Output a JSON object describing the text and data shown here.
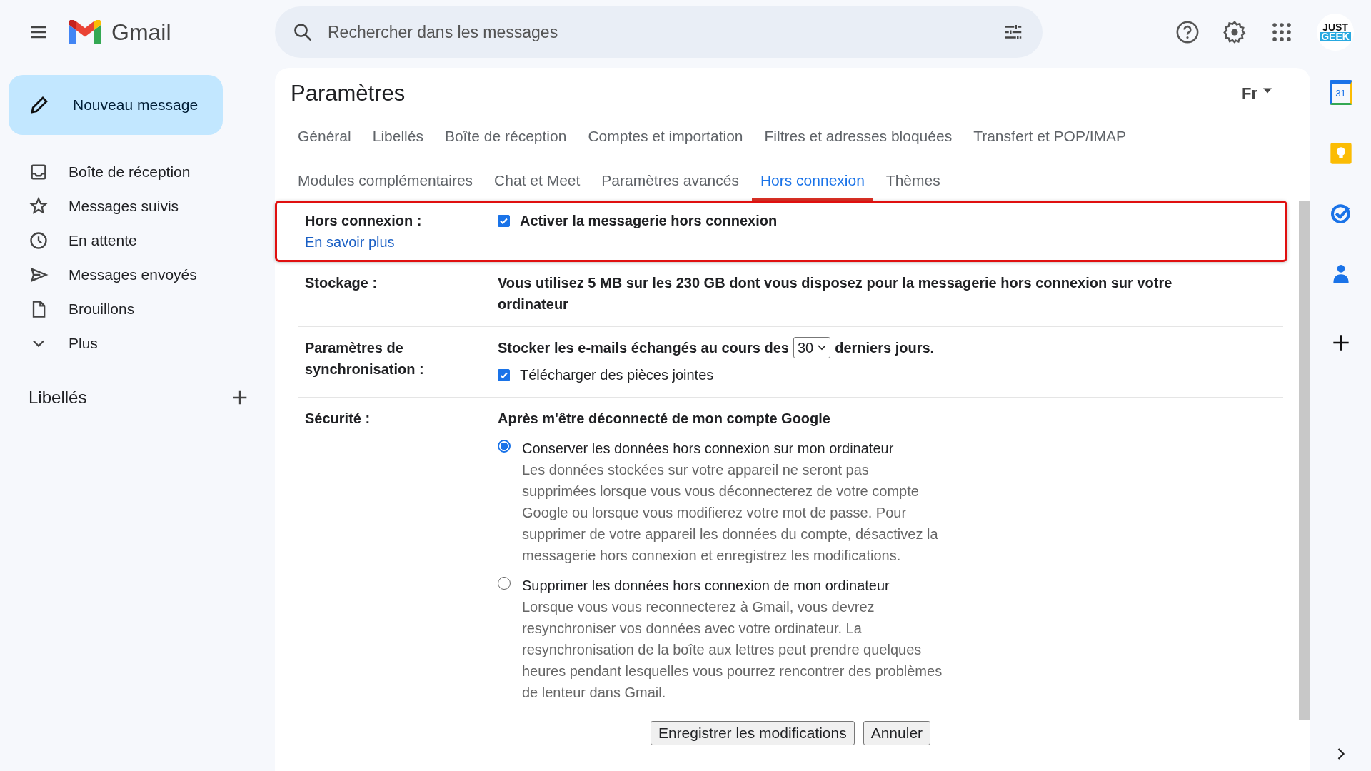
{
  "header": {
    "logo_text": "Gmail",
    "search_placeholder": "Rechercher dans les messages",
    "avatar_lines": [
      "JUST",
      "GEEK"
    ]
  },
  "sidebar": {
    "compose": "Nouveau message",
    "items": [
      {
        "kind": "inbox",
        "label": "Boîte de réception"
      },
      {
        "kind": "star",
        "label": "Messages suivis"
      },
      {
        "kind": "clock",
        "label": "En attente"
      },
      {
        "kind": "send",
        "label": "Messages envoyés"
      },
      {
        "kind": "file",
        "label": "Brouillons"
      },
      {
        "kind": "chevron",
        "label": "Plus"
      }
    ],
    "labels_heading": "Libellés"
  },
  "settings": {
    "title": "Paramètres",
    "input_tool": "Fr",
    "tab_rows": [
      [
        {
          "label": "Général",
          "selected": false
        },
        {
          "label": "Libellés",
          "selected": false
        },
        {
          "label": "Boîte de réception",
          "selected": false
        },
        {
          "label": "Comptes et importation",
          "selected": false
        },
        {
          "label": "Filtres et adresses bloquées",
          "selected": false
        },
        {
          "label": "Transfert et POP/IMAP",
          "selected": false
        }
      ],
      [
        {
          "label": "Modules complémentaires",
          "selected": false
        },
        {
          "label": "Chat et Meet",
          "selected": false
        },
        {
          "label": "Paramètres avancés",
          "selected": false
        },
        {
          "label": "Hors connexion",
          "selected": true
        },
        {
          "label": "Thèmes",
          "selected": false
        }
      ]
    ],
    "sections": [
      {
        "kind": "offline",
        "highlighted": true,
        "label": "Hors connexion :",
        "link": "En savoir plus",
        "checkbox": {
          "label": "Activer la messagerie hors connexion",
          "checked": true
        }
      },
      {
        "kind": "text",
        "label": "Stockage :",
        "text": "Vous utilisez 5 MB sur les 230 GB dont vous disposez pour la messagerie hors connexion sur votre ordinateur"
      },
      {
        "kind": "sync",
        "label": "Paramètres de synchronisation :",
        "before": "Stocker les e-mails échangés au cours des",
        "select": "30",
        "after": "derniers jours.",
        "checkbox": {
          "label": "Télécharger des pièces jointes",
          "checked": true
        }
      },
      {
        "kind": "radios",
        "label": "Sécurité :",
        "heading": "Après m'être déconnecté de mon compte Google",
        "options": [
          {
            "title": "Conserver les données hors connexion sur mon ordinateur",
            "description": "Les données stockées sur votre appareil ne seront pas supprimées lorsque vous vous déconnecterez de votre compte Google ou lorsque vous modifierez votre mot de passe. Pour supprimer de votre appareil les données du compte, désactivez la messagerie hors connexion et enregistrez les modifications.",
            "selected": true
          },
          {
            "title": "Supprimer les données hors connexion de mon ordinateur",
            "description": "Lorsque vous vous reconnecterez à Gmail, vous devrez resynchroniser vos données avec votre ordinateur. La resynchronisation de la boîte aux lettres peut prendre quelques heures pendant lesquelles vous pourrez rencontrer des problèmes de lenteur dans Gmail.",
            "selected": false
          }
        ]
      }
    ],
    "buttons": [
      "Enregistrer les modifications",
      "Annuler"
    ]
  },
  "rail": {
    "calendar_day": "31"
  }
}
